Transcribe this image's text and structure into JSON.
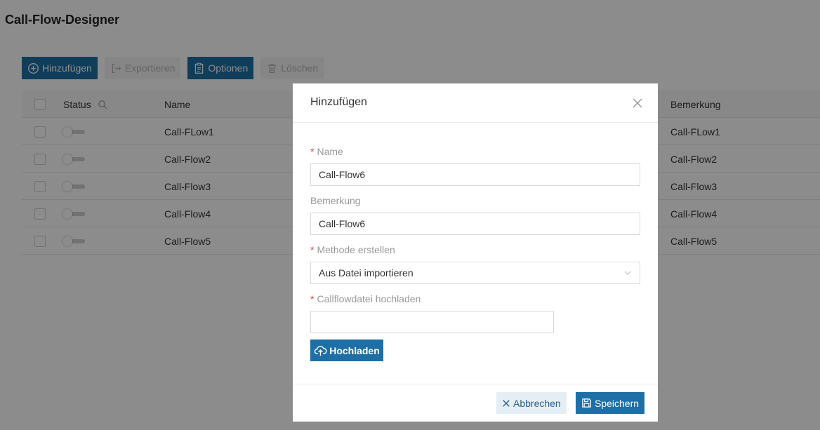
{
  "page": {
    "title": "Call-Flow-Designer"
  },
  "toolbar": {
    "add_label": "Hinzufügen",
    "export_label": "Exportieren",
    "options_label": "Optionen",
    "delete_label": "Löschen"
  },
  "table": {
    "headers": {
      "status": "Status",
      "name": "Name",
      "remark": "Bemerkung"
    },
    "rows": [
      {
        "name": "Call-FLow1",
        "remark": "Call-FLow1",
        "active": false
      },
      {
        "name": "Call-Flow2",
        "remark": "Call-Flow2",
        "active": false
      },
      {
        "name": "Call-Flow3",
        "remark": "Call-Flow3",
        "active": false
      },
      {
        "name": "Call-Flow4",
        "remark": "Call-Flow4",
        "active": false
      },
      {
        "name": "Call-Flow5",
        "remark": "Call-Flow5",
        "active": false
      }
    ]
  },
  "modal": {
    "title": "Hinzufügen",
    "name_label": "Name",
    "name_value": "Call-Flow6",
    "remark_label": "Bemerkung",
    "remark_value": "Call-Flow6",
    "method_label": "Methode erstellen",
    "method_value": "Aus Datei importieren",
    "file_label": "Callflowdatei hochladen",
    "file_value": "",
    "upload_label": "Hochladen",
    "cancel_label": "Abbrechen",
    "save_label": "Speichern",
    "required_mark": "*"
  },
  "colors": {
    "primary": "#1e6fa5",
    "required": "#e04040",
    "overlay": "rgba(0,0,0,0.45)"
  },
  "icons": {
    "add": "plus-circle-icon",
    "export": "export-icon",
    "options": "clipboard-icon",
    "delete": "trash-icon",
    "search": "search-icon",
    "close": "close-icon",
    "chevron": "chevron-down-icon",
    "upload": "cloud-upload-icon",
    "save": "save-icon",
    "cancel": "x-icon"
  }
}
